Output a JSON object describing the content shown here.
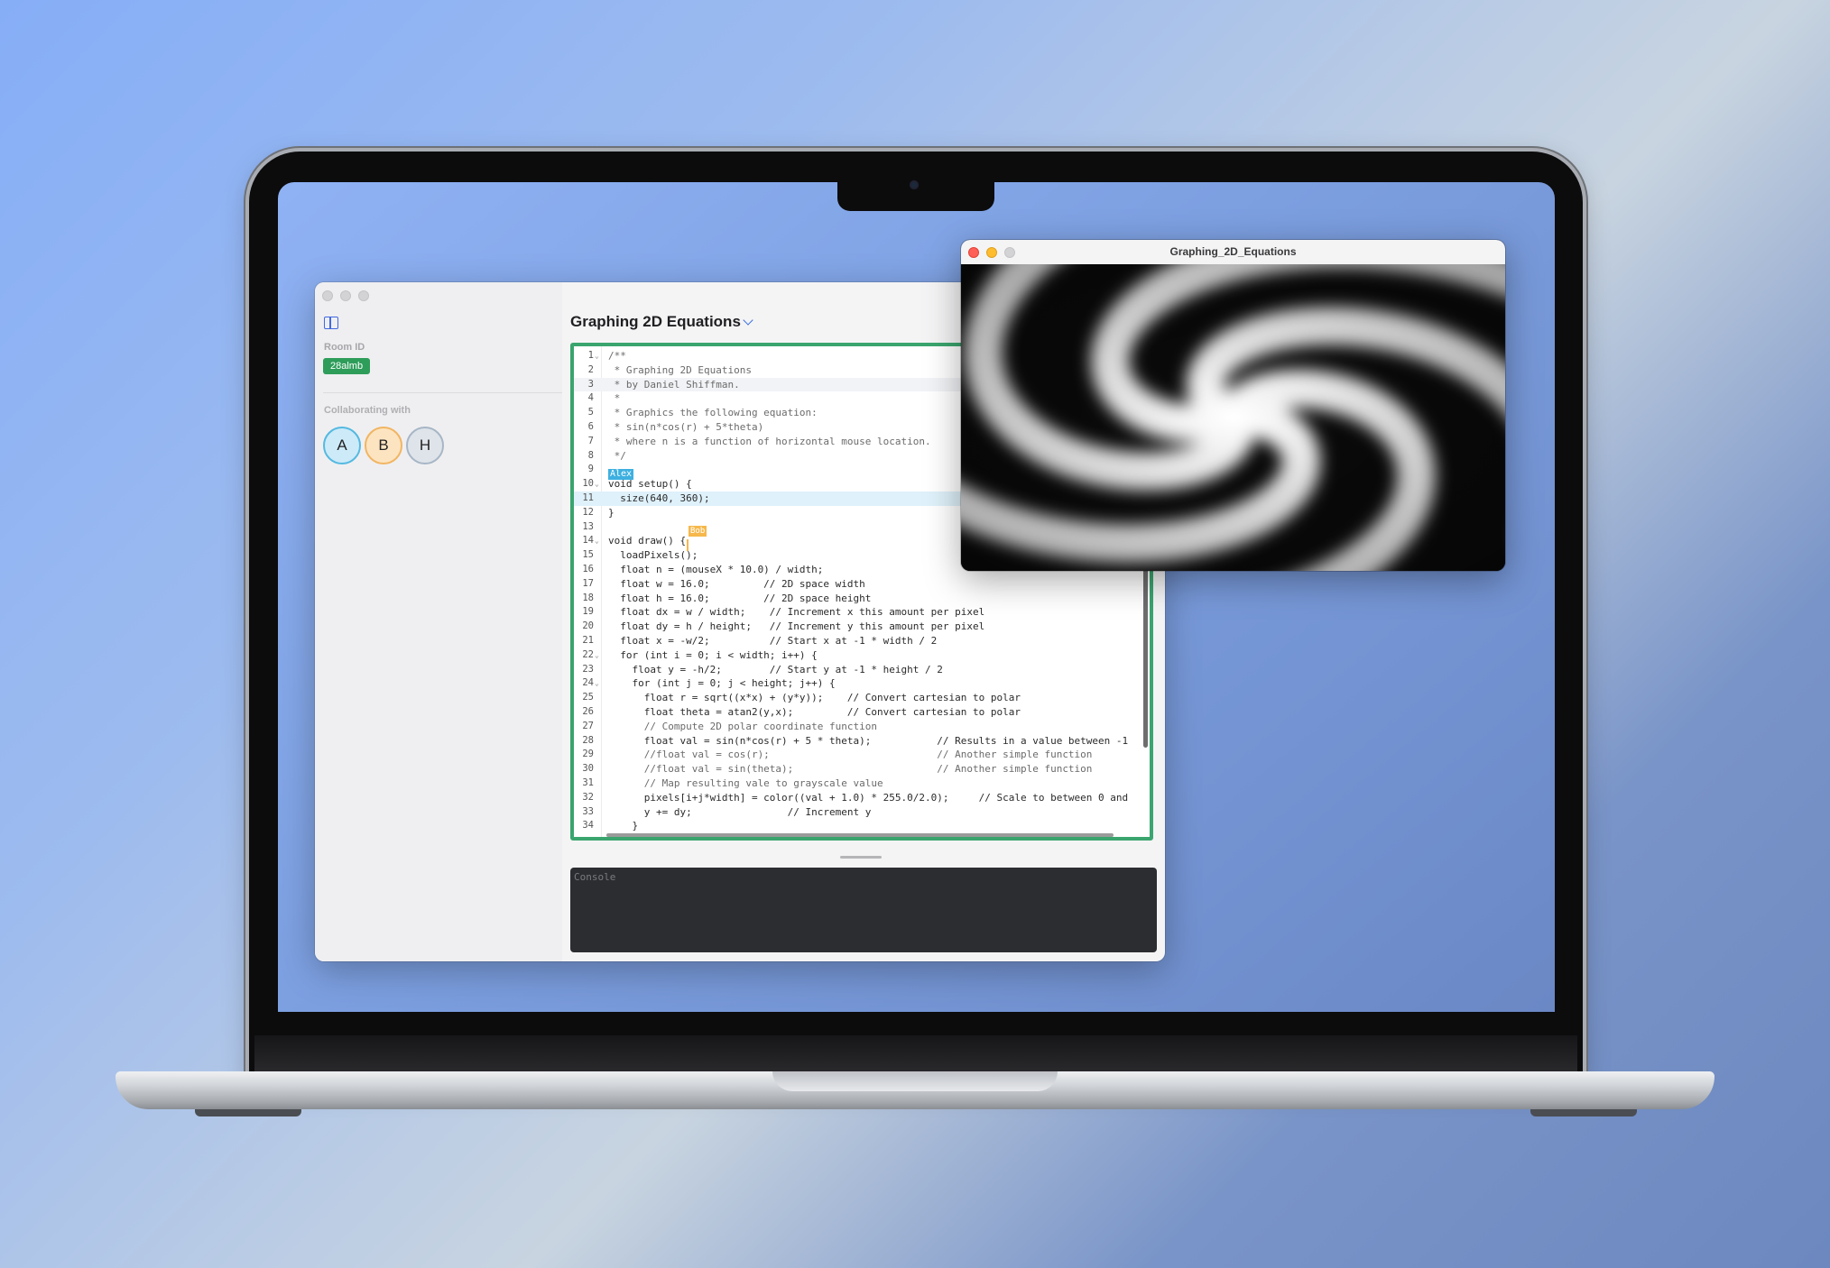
{
  "sidebar": {
    "room_label": "Room ID",
    "room_id": "28almb",
    "collab_label": "Collaborating with",
    "collaborators": [
      "A",
      "B",
      "H"
    ]
  },
  "editor": {
    "title": "Graphing 2D Equations",
    "cursor_tags": {
      "alex": "Alex",
      "bob": "Bob"
    },
    "line_numbers": [
      "1",
      "2",
      "3",
      "4",
      "5",
      "6",
      "7",
      "8",
      "9",
      "10",
      "11",
      "12",
      "13",
      "14",
      "15",
      "16",
      "17",
      "18",
      "19",
      "20",
      "21",
      "22",
      "23",
      "24",
      "25",
      "26",
      "27",
      "28",
      "29",
      "30",
      "31",
      "32",
      "33",
      "34"
    ],
    "lines": [
      "/**",
      " * Graphing 2D Equations",
      " * by Daniel Shiffman.",
      " *",
      " * Graphics the following equation:",
      " * sin(n*cos(r) + 5*theta)",
      " * where n is a function of horizontal mouse location.",
      " */",
      "",
      "void setup() {",
      "  size(640, 360);",
      "}",
      "",
      "void draw() {",
      "  loadPixels();",
      "  float n = (mouseX * 10.0) / width;",
      "  float w = 16.0;         // 2D space width",
      "  float h = 16.0;         // 2D space height",
      "  float dx = w / width;    // Increment x this amount per pixel",
      "  float dy = h / height;   // Increment y this amount per pixel",
      "  float x = -w/2;          // Start x at -1 * width / 2",
      "  for (int i = 0; i < width; i++) {",
      "    float y = -h/2;        // Start y at -1 * height / 2",
      "    for (int j = 0; j < height; j++) {",
      "      float r = sqrt((x*x) + (y*y));    // Convert cartesian to polar",
      "      float theta = atan2(y,x);         // Convert cartesian to polar",
      "      // Compute 2D polar coordinate function",
      "      float val = sin(n*cos(r) + 5 * theta);           // Results in a value between -1",
      "      //float val = cos(r);                            // Another simple function",
      "      //float val = sin(theta);                        // Another simple function",
      "      // Map resulting vale to grayscale value",
      "      pixels[i+j*width] = color((val + 1.0) * 255.0/2.0);     // Scale to between 0 and",
      "      y += dy;                // Increment y",
      "    }"
    ]
  },
  "console": {
    "placeholder": "Console"
  },
  "sketch": {
    "title": "Graphing_2D_Equations"
  },
  "colors": {
    "accent_green": "#3aa56e",
    "room_badge": "#2e9d5a",
    "alex": "#3eb0e0",
    "bob": "#f6b84c"
  }
}
